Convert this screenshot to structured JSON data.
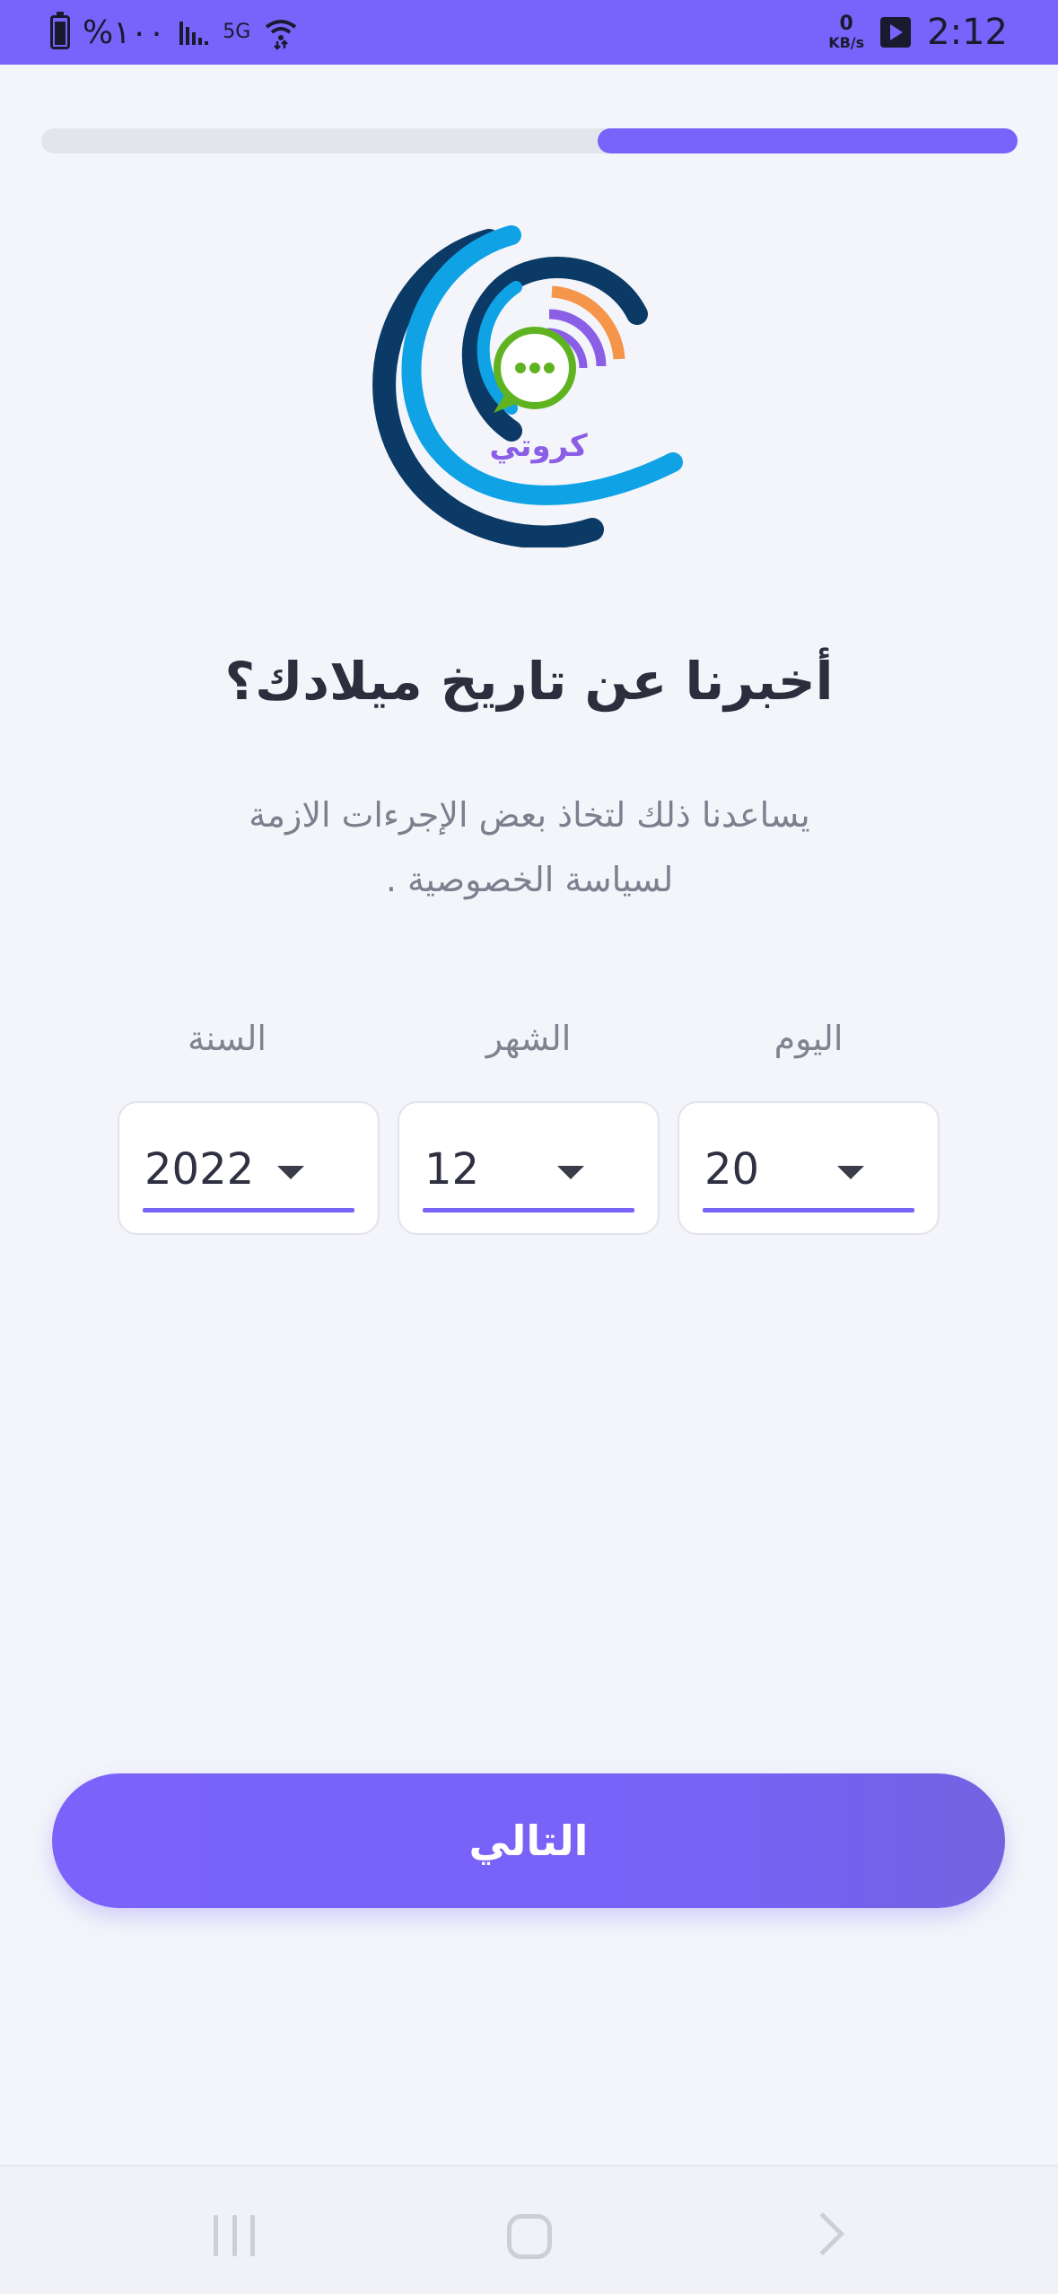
{
  "status_bar": {
    "battery_text": "%١٠٠",
    "signal_text": "ǀǀǀ.",
    "net_label": "5G",
    "kbs_value": "0",
    "kbs_unit": "KB/s",
    "time": "2:12"
  },
  "progress": {
    "fraction": 0.43
  },
  "logo": {
    "text": "كروتي"
  },
  "title": "أخبرنا عن تاريخ ميلادك؟",
  "subtitle_line1": "يساعدنا ذلك لتخاذ بعض الإجرءات الازمة",
  "subtitle_line2": "لسياسة الخصوصية .",
  "fields": {
    "day": {
      "label": "اليوم",
      "value": "20"
    },
    "month": {
      "label": "الشهر",
      "value": "12"
    },
    "year": {
      "label": "السنة",
      "value": "2022"
    }
  },
  "next_button_label": "التالي",
  "colors": {
    "accent": "#7864fa",
    "background": "#f4f5fa",
    "logo_dark_blue": "#0c3a66",
    "logo_light_blue": "#0fa3e6",
    "logo_green": "#5fb320",
    "logo_orange": "#f5954a",
    "logo_purple": "#8a5fe6"
  },
  "icons": [
    "battery-icon",
    "signal-icon",
    "wifi-icon",
    "play-icon",
    "recent-apps-icon",
    "home-icon",
    "back-icon",
    "dropdown-caret-icon"
  ]
}
